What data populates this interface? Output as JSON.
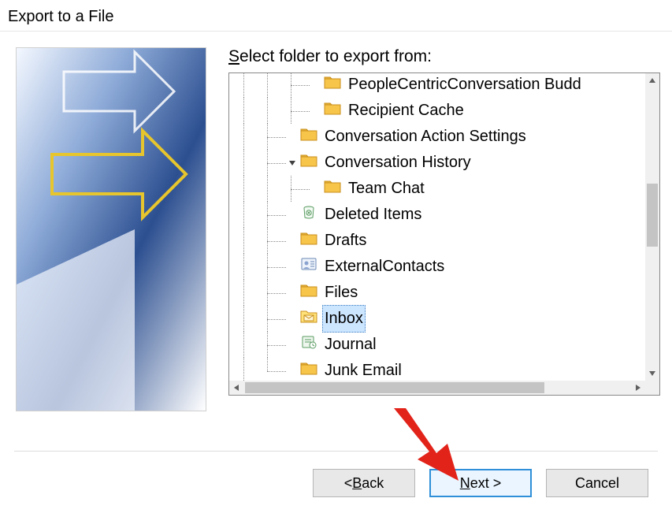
{
  "window": {
    "title": "Export to a File"
  },
  "prompt": {
    "pre": "S",
    "mnemonic": "",
    "label_html": "elect folder to export from:"
  },
  "tree": {
    "items": [
      {
        "label": "PeopleCentricConversation Budd",
        "depth": 3,
        "icon": "folder"
      },
      {
        "label": "Recipient Cache",
        "depth": 3,
        "icon": "folder"
      },
      {
        "label": "Conversation Action Settings",
        "depth": 2,
        "icon": "folder"
      },
      {
        "label": "Conversation History",
        "depth": 2,
        "icon": "folder",
        "expanded": true
      },
      {
        "label": "Team Chat",
        "depth": 3,
        "icon": "folder",
        "last": true
      },
      {
        "label": "Deleted Items",
        "depth": 2,
        "icon": "deleted"
      },
      {
        "label": "Drafts",
        "depth": 2,
        "icon": "folder"
      },
      {
        "label": "ExternalContacts",
        "depth": 2,
        "icon": "contacts"
      },
      {
        "label": "Files",
        "depth": 2,
        "icon": "folder"
      },
      {
        "label": "Inbox",
        "depth": 2,
        "icon": "inbox",
        "selected": true
      },
      {
        "label": "Journal",
        "depth": 2,
        "icon": "journal"
      },
      {
        "label": "Junk Email",
        "depth": 2,
        "icon": "folder"
      }
    ]
  },
  "buttons": {
    "back": {
      "pre": "< ",
      "mn": "B",
      "post": "ack"
    },
    "next": {
      "pre": "",
      "mn": "N",
      "post": "ext >"
    },
    "cancel": {
      "label": "Cancel"
    }
  }
}
